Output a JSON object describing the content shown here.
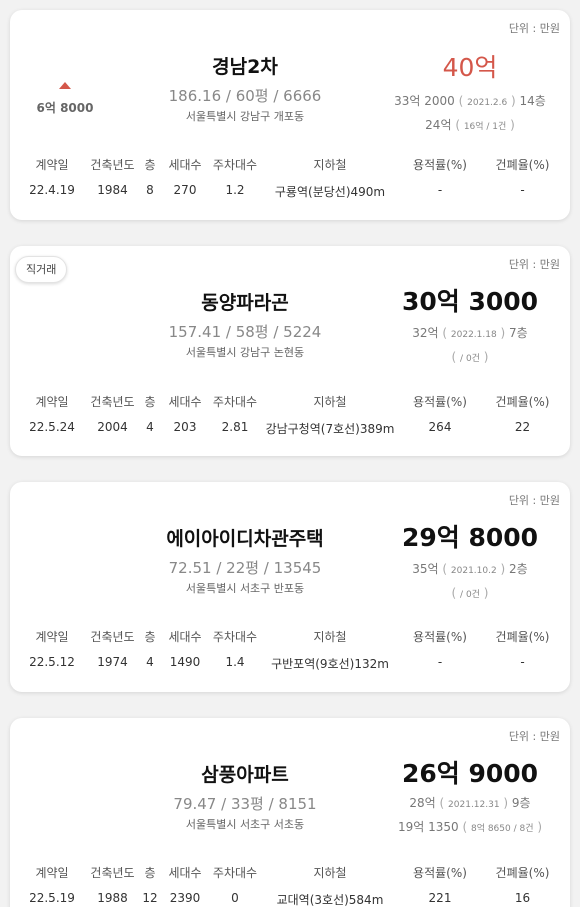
{
  "listings": [
    {
      "unit": "단위 : 만원",
      "name": "경남2차",
      "stats": "186.16 / 60평 / 6666",
      "address": "서울특별시 강남구 개포동",
      "change": "6억 8000",
      "price": "40억",
      "prev_price": "33억 2000",
      "prev_date": "2021.2.6",
      "prev_floor": "14층",
      "jeonse": "24억",
      "jeonse_detail": "16억 / 1건",
      "table": {
        "headers": [
          "계약일",
          "건축년도",
          "층",
          "세대수",
          "주차대수",
          "지하철",
          "용적률(%)",
          "건폐율(%)"
        ],
        "values": [
          "22.4.19",
          "1984",
          "8",
          "270",
          "1.2",
          "구룡역(분당선)490m",
          "-",
          "-"
        ]
      }
    },
    {
      "unit": "단위 : 만원",
      "badge": "직거래",
      "name": "동양파라곤",
      "stats": "157.41 / 58평 / 5224",
      "address": "서울특별시 강남구 논현동",
      "price": "30억 3000",
      "prev_price": "32억",
      "prev_date": "2022.1.18",
      "prev_floor": "7층",
      "jeonse_detail": "/ 0건",
      "table": {
        "headers": [
          "계약일",
          "건축년도",
          "층",
          "세대수",
          "주차대수",
          "지하철",
          "용적률(%)",
          "건폐율(%)"
        ],
        "values": [
          "22.5.24",
          "2004",
          "4",
          "203",
          "2.81",
          "강남구청역(7호선)389m",
          "264",
          "22"
        ]
      }
    },
    {
      "unit": "단위 : 만원",
      "name": "에이아이디차관주택",
      "stats": "72.51 / 22평 / 13545",
      "address": "서울특별시 서초구 반포동",
      "price": "29억 8000",
      "prev_price": "35억",
      "prev_date": "2021.10.2",
      "prev_floor": "2층",
      "jeonse_detail": "/ 0건",
      "table": {
        "headers": [
          "계약일",
          "건축년도",
          "층",
          "세대수",
          "주차대수",
          "지하철",
          "용적률(%)",
          "건폐율(%)"
        ],
        "values": [
          "22.5.12",
          "1974",
          "4",
          "1490",
          "1.4",
          "구반포역(9호선)132m",
          "-",
          "-"
        ]
      }
    },
    {
      "unit": "단위 : 만원",
      "name": "삼풍아파트",
      "stats": "79.47 / 33평 / 8151",
      "address": "서울특별시 서초구 서초동",
      "price": "26억 9000",
      "prev_price": "28억",
      "prev_date": "2021.12.31",
      "prev_floor": "9층",
      "jeonse": "19억 1350",
      "jeonse_detail": "8억 8650 / 8건",
      "table": {
        "headers": [
          "계약일",
          "건축년도",
          "층",
          "세대수",
          "주차대수",
          "지하철",
          "용적률(%)",
          "건폐율(%)"
        ],
        "values": [
          "22.5.19",
          "1988",
          "12",
          "2390",
          "0",
          "교대역(3호선)584m",
          "221",
          "16"
        ]
      }
    }
  ]
}
